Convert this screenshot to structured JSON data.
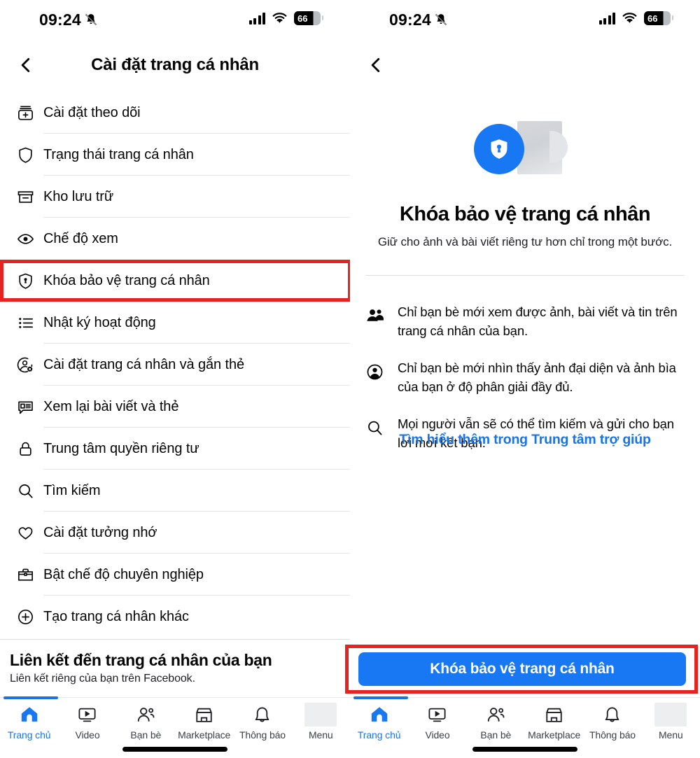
{
  "status_bar": {
    "time": "09:24",
    "mute_icon": "bell-slash-icon",
    "signal_icon": "cellular-signal-icon",
    "wifi_icon": "wifi-icon",
    "battery_level": "66"
  },
  "left_panel": {
    "back_icon": "chevron-left-icon",
    "title": "Cài đặt trang cá nhân",
    "highlight_color": "#e52420",
    "menu_items": [
      {
        "icon": "follow-settings-icon",
        "label": "Cài đặt theo dõi",
        "highlighted": false
      },
      {
        "icon": "shield-icon",
        "label": "Trạng thái trang cá nhân",
        "highlighted": false
      },
      {
        "icon": "archive-box-icon",
        "label": "Kho lưu trữ",
        "highlighted": false
      },
      {
        "icon": "eye-icon",
        "label": "Chế độ xem",
        "highlighted": false
      },
      {
        "icon": "shield-lock-icon",
        "label": "Khóa bảo vệ trang cá nhân",
        "highlighted": true
      },
      {
        "icon": "activity-log-icon",
        "label": "Nhật ký hoạt động",
        "highlighted": false
      },
      {
        "icon": "profile-tag-settings-icon",
        "label": "Cài đặt trang cá nhân và gắn thẻ",
        "highlighted": false
      },
      {
        "icon": "review-posts-icon",
        "label": "Xem lại bài viết và thẻ",
        "highlighted": false
      },
      {
        "icon": "padlock-icon",
        "label": "Trung tâm quyền riêng tư",
        "highlighted": false
      },
      {
        "icon": "search-icon",
        "label": "Tìm kiếm",
        "highlighted": false
      },
      {
        "icon": "heart-icon",
        "label": "Cài đặt tưởng nhớ",
        "highlighted": false
      },
      {
        "icon": "briefcase-icon",
        "label": "Bật chế độ chuyên nghiệp",
        "highlighted": false
      },
      {
        "icon": "plus-circle-icon",
        "label": "Tạo trang cá nhân khác",
        "highlighted": false
      }
    ],
    "link_section": {
      "title": "Liên kết đến trang cá nhân của bạn",
      "subtitle": "Liên kết riêng của bạn trên Facebook."
    }
  },
  "right_panel": {
    "back_icon": "chevron-left-icon",
    "hero_icon": "shield-lock-badge-icon",
    "title": "Khóa bảo vệ trang cá nhân",
    "subtitle": "Giữ cho ảnh và bài viết riêng tư hơn chỉ trong một bước.",
    "bullets": [
      {
        "icon": "friends-icon",
        "text": "Chỉ bạn bè mới xem được ảnh, bài viết và tin trên trang cá nhân của bạn."
      },
      {
        "icon": "profile-circle-icon",
        "text": "Chỉ bạn bè mới nhìn thấy ảnh đại diện và ảnh bìa của bạn ở độ phân giải đầy đủ."
      },
      {
        "icon": "search-icon",
        "text": "Mọi người vẫn sẽ có thể tìm kiếm và gửi cho bạn lời mời kết bạn."
      }
    ],
    "help_link": "Tìm hiểu thêm trong Trung tâm trợ giúp",
    "cta_label": "Khóa bảo vệ trang cá nhân",
    "cta_color": "#1877f2",
    "highlight_color": "#e52420"
  },
  "bottom_nav": {
    "items": [
      {
        "icon": "home-icon",
        "label": "Trang chủ",
        "active": true
      },
      {
        "icon": "video-icon",
        "label": "Video",
        "active": false
      },
      {
        "icon": "friends-icon",
        "label": "Bạn bè",
        "active": false
      },
      {
        "icon": "marketplace-icon",
        "label": "Marketplace",
        "active": false
      },
      {
        "icon": "bell-icon",
        "label": "Thông báo",
        "active": false
      },
      {
        "icon": "menu-placeholder-icon",
        "label": "Menu",
        "active": false
      }
    ]
  }
}
